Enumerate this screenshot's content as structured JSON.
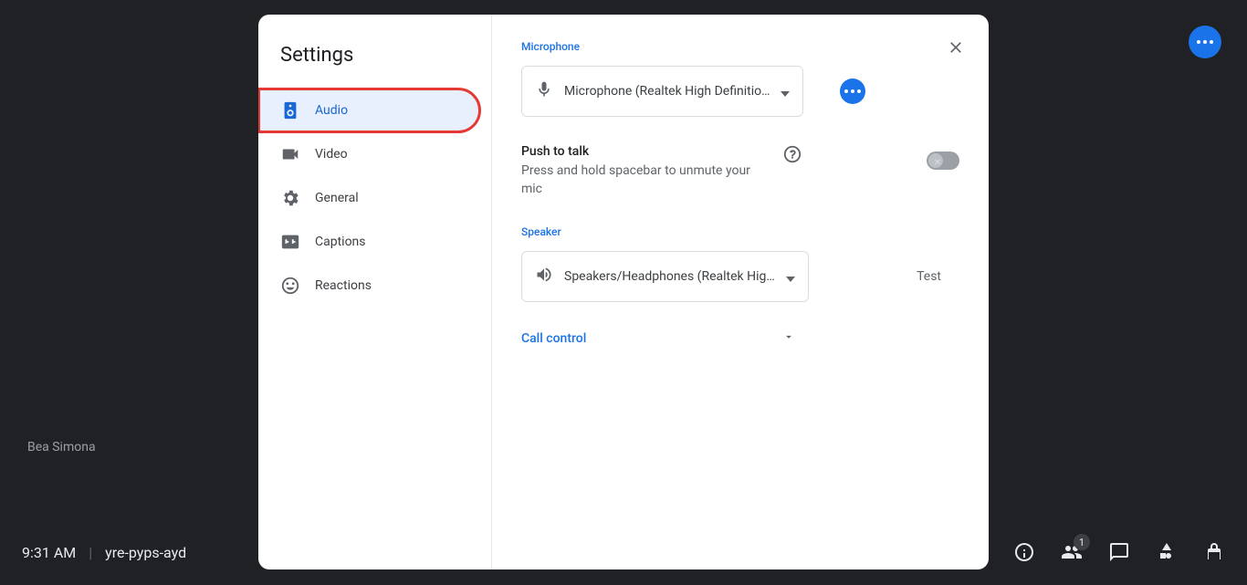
{
  "background": {
    "participant_name": "Bea Simona",
    "time": "9:31 AM",
    "meeting_code": "yre-pyps-ayd",
    "people_badge": "1"
  },
  "dialog": {
    "title": "Settings",
    "nav": [
      {
        "label": "Audio"
      },
      {
        "label": "Video"
      },
      {
        "label": "General"
      },
      {
        "label": "Captions"
      },
      {
        "label": "Reactions"
      }
    ],
    "audio": {
      "mic_label": "Microphone",
      "mic_value": "Microphone (Realtek High Definitio…",
      "ptt_title": "Push to talk",
      "ptt_desc": "Press and hold spacebar to unmute your mic",
      "speaker_label": "Speaker",
      "speaker_value": "Speakers/Headphones (Realtek Hig…",
      "test_label": "Test",
      "call_control_label": "Call control"
    }
  }
}
